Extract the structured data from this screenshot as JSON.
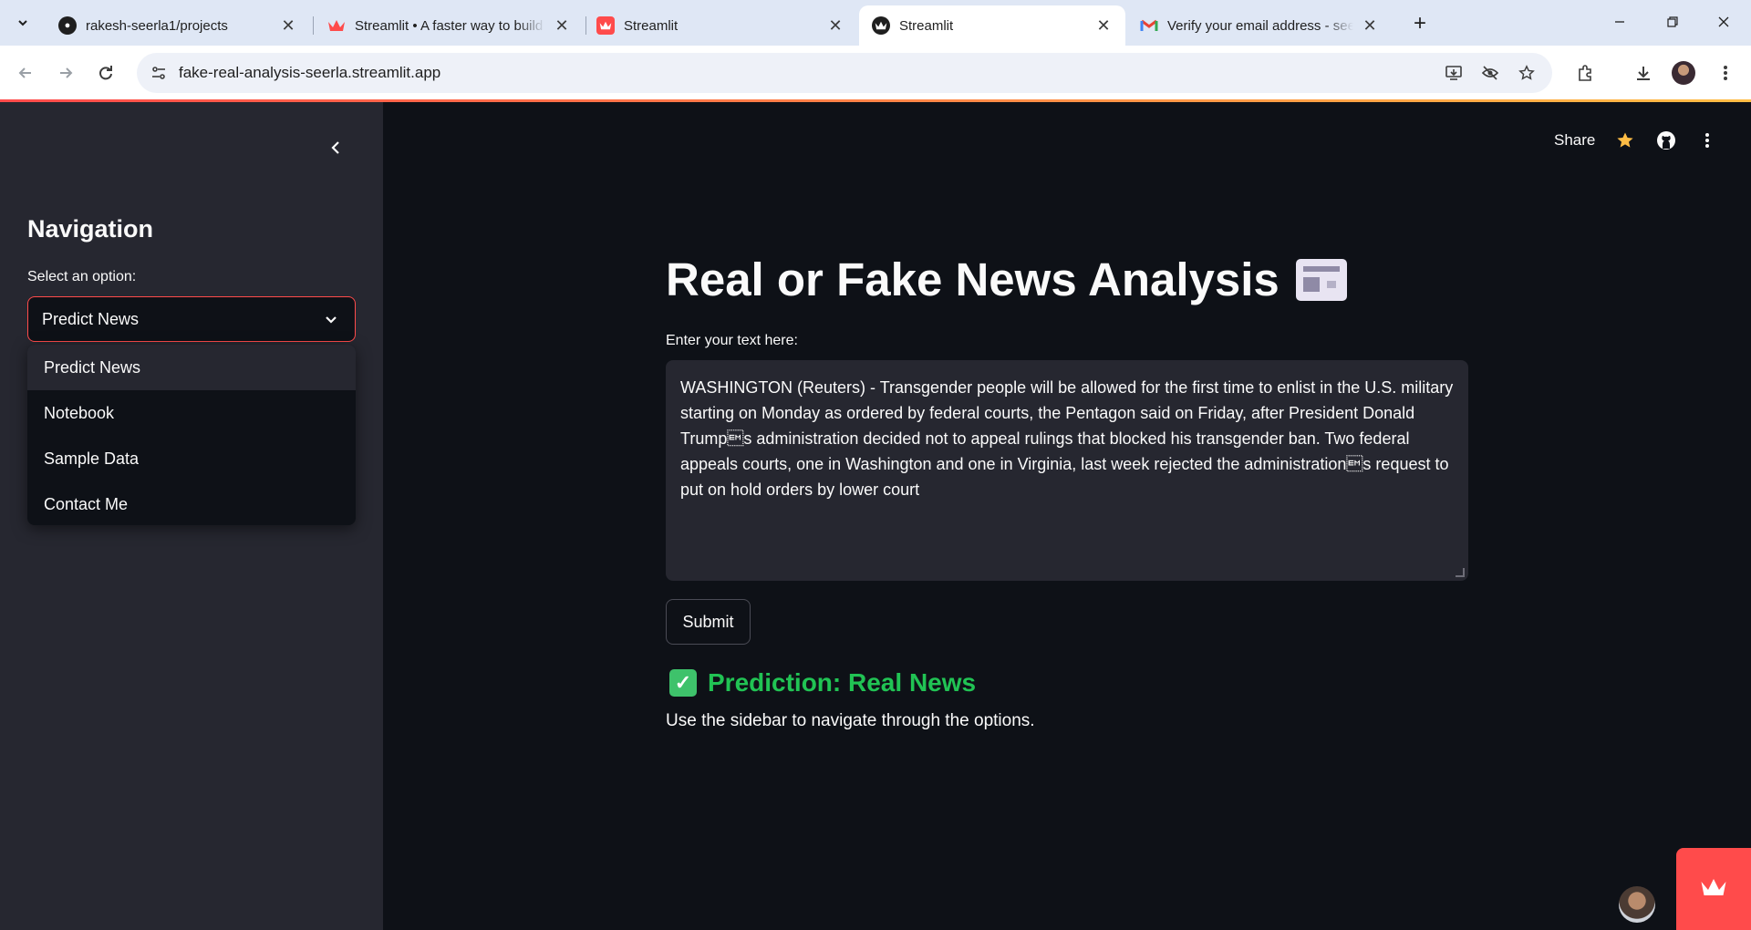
{
  "browser": {
    "tabs": [
      {
        "title": "rakesh-seerla1/projects",
        "favicon": "github-icon"
      },
      {
        "title": "Streamlit • A faster way to build",
        "favicon": "streamlit-crown-icon"
      },
      {
        "title": "Streamlit",
        "favicon": "streamlit-red-icon"
      },
      {
        "title": "Streamlit",
        "favicon": "streamlit-crown-icon",
        "active": true
      },
      {
        "title": "Verify your email address - seerla",
        "favicon": "gmail-icon"
      }
    ],
    "url": "fake-real-analysis-seerla.streamlit.app"
  },
  "sidebar": {
    "title": "Navigation",
    "select_label": "Select an option:",
    "selected": "Predict News",
    "options": [
      "Predict News",
      "Notebook",
      "Sample Data",
      "Contact Me"
    ]
  },
  "header": {
    "share": "Share"
  },
  "main": {
    "title": "Real or Fake News Analysis",
    "text_label": "Enter your text here:",
    "text_value": "WASHINGTON (Reuters) - Transgender people will be allowed for the first time to enlist in the U.S. military starting on Monday as ordered by federal courts, the Pentagon said on Friday, after President Donald Trump\u0019s administration decided not to appeal rulings that blocked his transgender ban. Two federal appeals courts, one in Washington and one in Virginia, last week rejected the administration\u0019s request to put on hold orders by lower court",
    "submit_label": "Submit",
    "prediction": "Prediction: Real News",
    "info": "Use the sidebar to navigate through the options."
  },
  "colors": {
    "primary": "#ff4b4b",
    "success": "#21c354",
    "background": "#0e1117",
    "secondary_background": "#262730"
  }
}
